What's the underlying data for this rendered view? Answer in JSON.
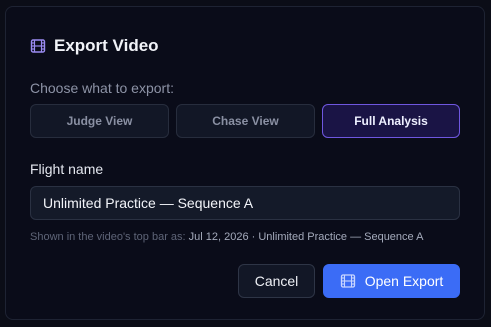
{
  "dialog": {
    "title": "Export Video",
    "icon": "film-icon",
    "choose_label": "Choose what to export:",
    "options": [
      {
        "label": "Judge View",
        "selected": false
      },
      {
        "label": "Chase View",
        "selected": false
      },
      {
        "label": "Full Analysis",
        "selected": true
      }
    ],
    "flight_name_label": "Flight name",
    "flight_name_value": "Unlimited Practice — Sequence A",
    "hint_prefix": "Shown in the video's top bar as:",
    "hint_value": "Jul 12, 2026 · Unlimited Practice — Sequence A",
    "cancel_label": "Cancel",
    "open_label": "Open Export",
    "open_icon": "film-icon"
  },
  "colors": {
    "background": "#0a0c19",
    "accent": "#3b6cf6",
    "selected_border": "#6f57e0",
    "selected_bg": "#1a1445",
    "title_icon": "#9b8cf2"
  }
}
